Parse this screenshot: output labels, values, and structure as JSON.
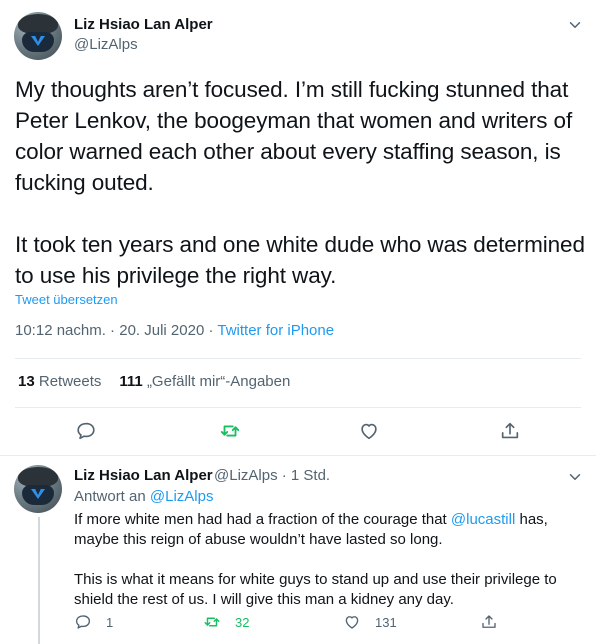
{
  "main_tweet": {
    "author_name": "Liz Hsiao Lan Alper",
    "author_handle": "@LizAlps",
    "paragraph_1": "My thoughts aren’t focused. I’m still fucking stunned that Peter Lenkov, the boogeyman that women and writers of color warned each other about every staffing season, is fucking outed.",
    "paragraph_2": "It took ten years and one white dude who was determined to use his privilege the right way.",
    "translate_label": "Tweet übersetzen",
    "timestamp": "10:12 nachm. · 20. Juli 2020 · ",
    "source": "Twitter for iPhone",
    "retweets_count": "13",
    "retweets_label": "Retweets",
    "likes_count": "111",
    "likes_label": "„Gefällt mir“-Angaben"
  },
  "reply_tweet": {
    "author_name": "Liz Hsiao Lan Alper",
    "author_handle_time": "@LizAlps · 1 Std.",
    "reply_to_prefix": "Antwort an ",
    "reply_to_handle": "@LizAlps",
    "line_1_before": "If more white men had had a fraction of the courage that ",
    "line_1_mention": "@lucastill",
    "line_1_after": " has, maybe this reign of abuse wouldn’t have lasted so long.",
    "paragraph_2": "This is what it means for white guys to stand up and use their privilege to shield the rest of us. I will give this man a kidney any day.",
    "reply_count": "1",
    "retweet_count": "32",
    "like_count": "131"
  },
  "icons": [
    "avatar",
    "chevron-down-icon",
    "reply-icon",
    "retweet-icon",
    "like-icon",
    "share-icon"
  ],
  "colors": {
    "link": "#1d9bf0",
    "retweet": "#17bf63",
    "secondary_text": "#536471"
  }
}
